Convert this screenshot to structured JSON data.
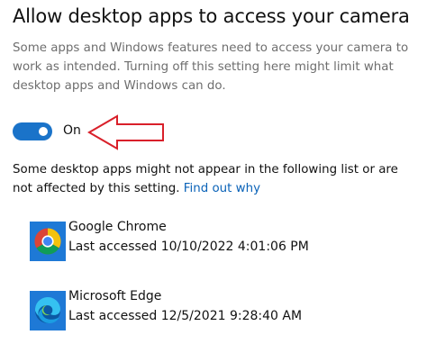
{
  "page": {
    "title": "Allow desktop apps to access your camera",
    "description": "Some apps and Windows features need to access your camera to work as intended. Turning off this setting here might limit what desktop apps and Windows can do.",
    "toggle": {
      "state_label": "On",
      "on": true,
      "accent": "#1a73c9"
    },
    "note": {
      "text": "Some desktop apps might not appear in the following list or are not affected by this setting.",
      "link_text": "Find out why"
    }
  },
  "apps": [
    {
      "name": "Google Chrome",
      "accessed": "Last accessed 10/10/2022 4:01:06 PM",
      "icon": "chrome-icon"
    },
    {
      "name": "Microsoft Edge",
      "accessed": "Last accessed 12/5/2021 9:28:40 AM",
      "icon": "edge-icon"
    }
  ],
  "annotation": {
    "arrow_color": "#d9202a",
    "icon": "red-arrow-icon"
  }
}
